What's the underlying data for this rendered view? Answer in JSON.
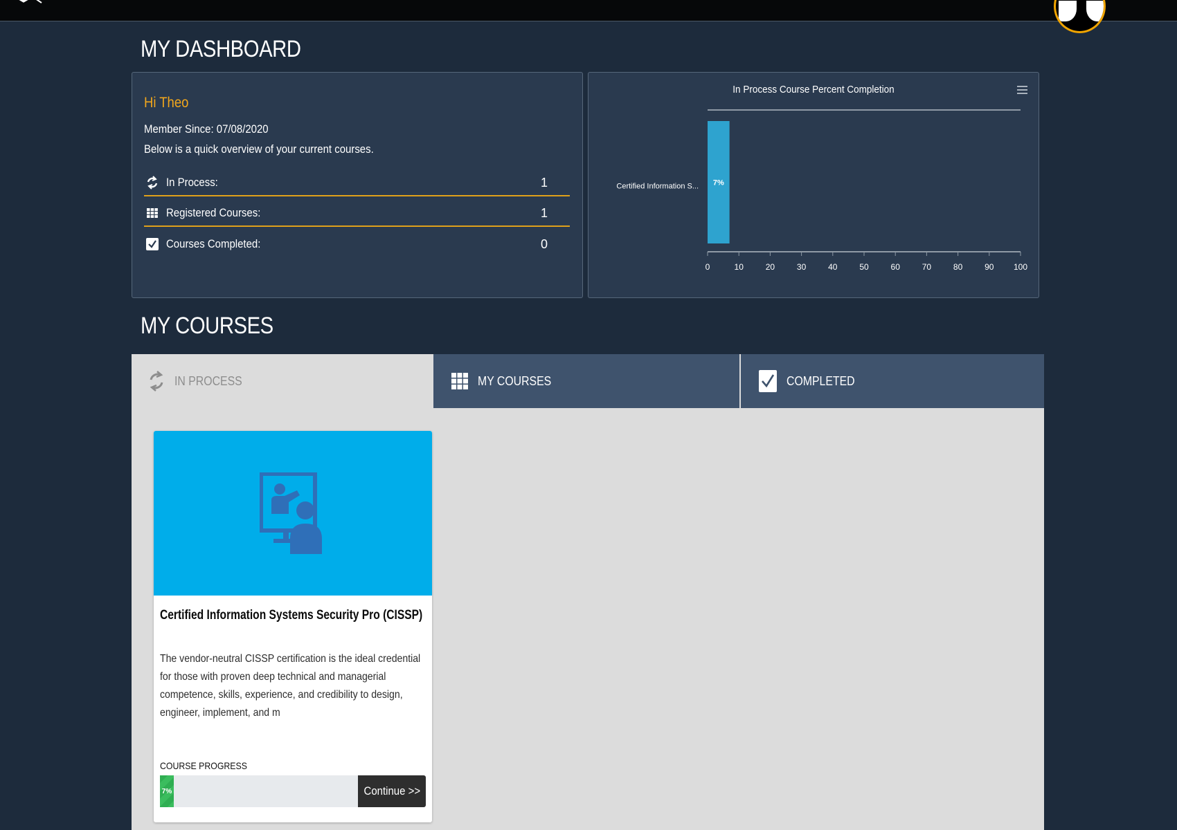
{
  "header": {
    "logo_icon": "chevron-logo-icon",
    "avatar_icon": "user-avatar-icon"
  },
  "dashboard": {
    "title": "MY DASHBOARD",
    "greeting": "Hi Theo",
    "member_since": "Member Since: 07/08/2020",
    "overview_text": "Below is a quick overview of your current courses.",
    "stats": [
      {
        "label": "In Process:",
        "value": "1",
        "icon": "refresh-icon"
      },
      {
        "label": "Registered Courses:",
        "value": "1",
        "icon": "grid-icon"
      },
      {
        "label": "Courses Completed:",
        "value": "0",
        "icon": "checkbox-icon"
      }
    ]
  },
  "chart_data": {
    "type": "bar",
    "orientation": "horizontal",
    "title": "In Process Course Percent Completion",
    "categories": [
      "Certified Information S..."
    ],
    "values": [
      7
    ],
    "data_labels": [
      "7%"
    ],
    "xlim": [
      0,
      100
    ],
    "xticks": [
      0,
      10,
      20,
      30,
      40,
      50,
      60,
      70,
      80,
      90,
      100
    ],
    "grid": false,
    "legend": "none",
    "bar_color": "#2ea3cf"
  },
  "courses": {
    "title": "MY COURSES",
    "tabs": [
      {
        "label": "IN PROCESS",
        "icon": "refresh-icon",
        "active": true
      },
      {
        "label": "MY COURSES",
        "icon": "grid-icon",
        "active": false
      },
      {
        "label": "COMPLETED",
        "icon": "checkbox-icon",
        "active": false
      }
    ],
    "card": {
      "image_icon": "presentation-icon",
      "title": "Certified Information Systems Security Pro (CISSP)",
      "description": "The vendor-neutral CISSP certification is the ideal credential for those with proven deep technical and managerial competence, skills, experience, and credibility to design, engineer, implement, and m",
      "progress_label": "COURSE PROGRESS",
      "progress_percent": 7,
      "progress_text": "7%",
      "button_label": "Continue >>"
    }
  },
  "colors": {
    "background": "#1d2b3c",
    "panel": "#2a3a4f",
    "accent": "#f2a71c",
    "tab_inactive": "#3f536d",
    "card_banner": "#00adea",
    "progress": "#2fae52"
  }
}
